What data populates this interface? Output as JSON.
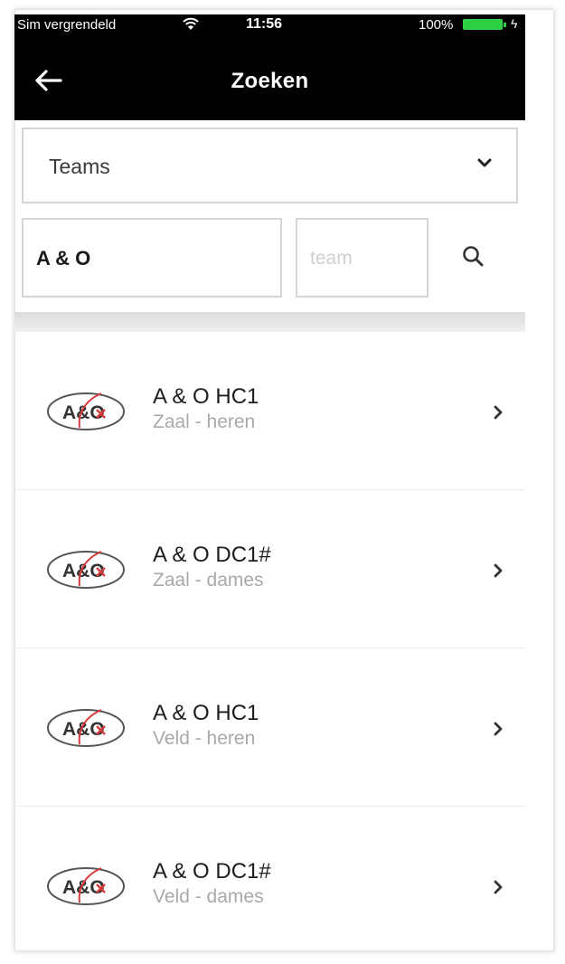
{
  "status_bar": {
    "carrier": "Sim vergrendeld",
    "time": "11:56",
    "battery": "100%",
    "battery_color": "#2fcf43"
  },
  "header": {
    "title": "Zoeken",
    "back_icon": "arrow-left-icon",
    "background": "#000000"
  },
  "filter": {
    "selected": "Teams",
    "icon": "chevron-down-icon"
  },
  "search": {
    "query": "A & O",
    "team_placeholder": "team",
    "icon": "search-icon"
  },
  "results": [
    {
      "name": "A & O HC1",
      "subtitle": "Zaal - heren"
    },
    {
      "name": "A & O DC1#",
      "subtitle": "Zaal - dames"
    },
    {
      "name": "A & O HC1",
      "subtitle": "Veld - heren"
    },
    {
      "name": "A & O DC1#",
      "subtitle": "Veld - dames"
    }
  ],
  "logo_text": "A&O"
}
